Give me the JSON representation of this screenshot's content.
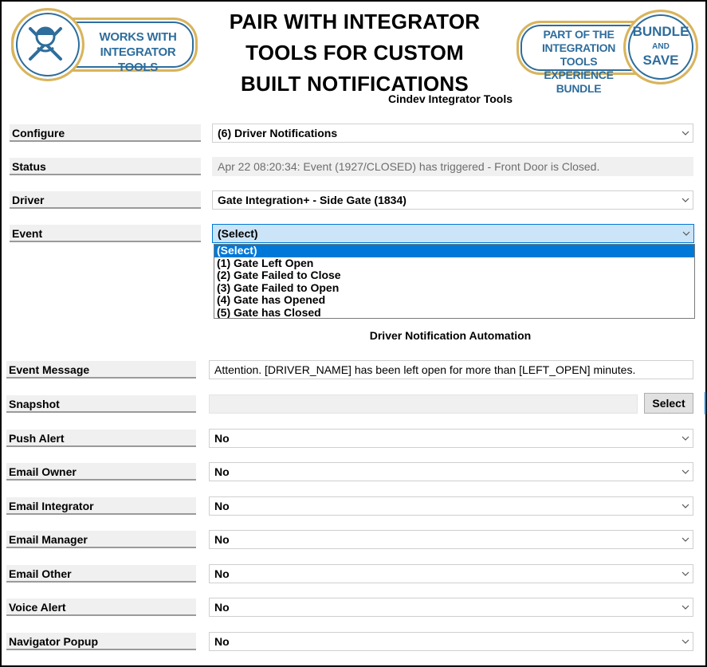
{
  "header": {
    "headline_lines": [
      "PAIR WITH INTEGRATOR",
      "TOOLS FOR CUSTOM",
      "BUILT NOTIFICATIONS"
    ],
    "badge_left_text": "WORKS WITH INTEGRATOR TOOLS",
    "badge_right_text": "PART OF THE INTEGRATION TOOLS EXPERIENCE BUNDLE",
    "badge_right_circle": [
      "BUNDLE",
      "AND",
      "SAVE"
    ],
    "badge_icon": "worker-tools-icon",
    "accent_gold": "#d9b45a",
    "accent_blue": "#2e6d9c"
  },
  "top_section_title": "Cindev Integrator Tools",
  "top_rows": {
    "configure": {
      "label": "Configure",
      "value": "(6) Driver Notifications"
    },
    "status": {
      "label": "Status",
      "value": "Apr 22 08:20:34: Event (1927/CLOSED) has triggered - Front Door is Closed."
    },
    "driver": {
      "label": "Driver",
      "value": "Gate Integration+ - Side Gate (1834)"
    },
    "event": {
      "label": "Event",
      "value": "(Select)"
    }
  },
  "event_dropdown": {
    "options": [
      "(Select)",
      "(1) Gate Left Open",
      "(2) Gate Failed to Close",
      "(3) Gate Failed to Open",
      "(4) Gate has Opened",
      "(5) Gate has Closed"
    ],
    "selected_index": 0
  },
  "automation_section_title": "Driver Notification Automation",
  "automation": {
    "event_message": {
      "label": "Event Message",
      "value": "Attention. [DRIVER_NAME] has been left open for more than [LEFT_OPEN] minutes."
    },
    "snapshot": {
      "label": "Snapshot",
      "value": "",
      "button": "Select"
    },
    "push_alert": {
      "label": "Push Alert",
      "value": "No"
    },
    "email_owner": {
      "label": "Email Owner",
      "value": "No"
    },
    "email_integrator": {
      "label": "Email Integrator",
      "value": "No"
    },
    "email_manager": {
      "label": "Email Manager",
      "value": "No"
    },
    "email_other": {
      "label": "Email Other",
      "value": "No"
    },
    "voice_alert": {
      "label": "Voice Alert",
      "value": "No"
    },
    "navigator_popup": {
      "label": "Navigator Popup",
      "value": "No"
    }
  }
}
